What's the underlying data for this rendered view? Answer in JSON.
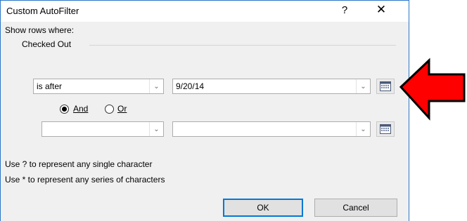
{
  "dialog": {
    "title": "Custom AutoFilter",
    "help_label": "?",
    "close_label": "✕"
  },
  "filter": {
    "show_rows_label": "Show rows where:",
    "column_name": "Checked Out",
    "row1": {
      "operator": "is after",
      "value": "9/20/14"
    },
    "row2": {
      "operator": "",
      "value": ""
    },
    "and_label": "And",
    "or_label": "Or",
    "selected_logic": "And"
  },
  "hints": {
    "line1": "Use ? to represent any single character",
    "line2": "Use * to represent any series of characters"
  },
  "buttons": {
    "ok": "OK",
    "cancel": "Cancel"
  },
  "annotation": {
    "arrow_color": "#ff0000",
    "outline_color": "#000000"
  }
}
